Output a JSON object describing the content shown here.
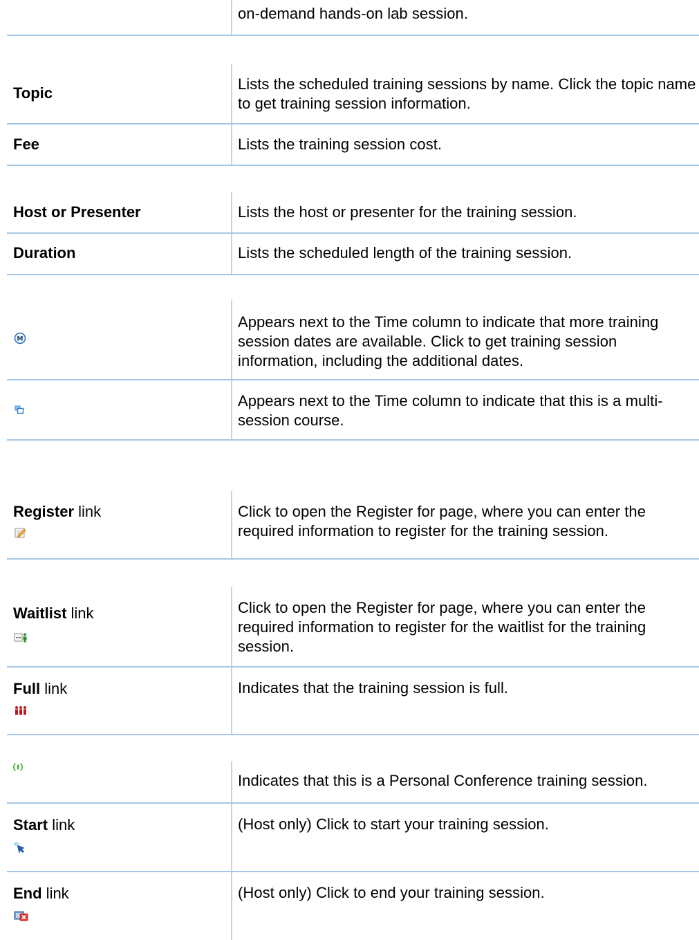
{
  "rows": [
    {
      "term": "",
      "term_suffix": "",
      "icon": "",
      "desc": "on-demand hands-on lab session."
    },
    {
      "term": "Topic",
      "term_suffix": "",
      "icon": "",
      "desc": "Lists the scheduled training sessions by name. Click the topic name to get training session information."
    },
    {
      "term": "Fee",
      "term_suffix": "",
      "icon": "",
      "desc": "Lists the training session cost."
    },
    {
      "term": "Host or Presenter",
      "term_suffix": "",
      "icon": "",
      "desc": "Lists the host or presenter for the training session."
    },
    {
      "term": "Duration",
      "term_suffix": "",
      "icon": "",
      "desc": "Lists the scheduled length of the training session."
    },
    {
      "term": "",
      "term_suffix": "",
      "icon": "more-dates-icon",
      "desc": "Appears next to the Time column to indicate that more training session dates are available. Click to get training session information, including the additional dates."
    },
    {
      "term": "",
      "term_suffix": "",
      "icon": "multi-session-icon",
      "desc": "Appears next to the Time column to indicate that this is a multi-session course."
    },
    {
      "term": "Register",
      "term_suffix": " link",
      "icon": "register-icon",
      "desc": "Click to open the Register for page, where you can enter the required information to register for the training session."
    },
    {
      "term": "Waitlist",
      "term_suffix": " link",
      "icon": "waitlist-icon",
      "desc": "Click to open the Register for page, where you can enter the required information to register for the waitlist for the training session."
    },
    {
      "term": "Full",
      "term_suffix": " link",
      "icon": "full-icon",
      "desc": "Indicates that the training session is full."
    },
    {
      "term": "",
      "term_suffix": "",
      "icon": "personal-conference-icon",
      "desc": "Indicates that this is a Personal Conference training session."
    },
    {
      "term": "Start",
      "term_suffix": " link",
      "icon": "start-icon",
      "desc": "(Host only) Click to start your training session."
    },
    {
      "term": "End",
      "term_suffix": " link",
      "icon": "end-icon",
      "desc": "(Host only) Click to end your training session."
    }
  ]
}
